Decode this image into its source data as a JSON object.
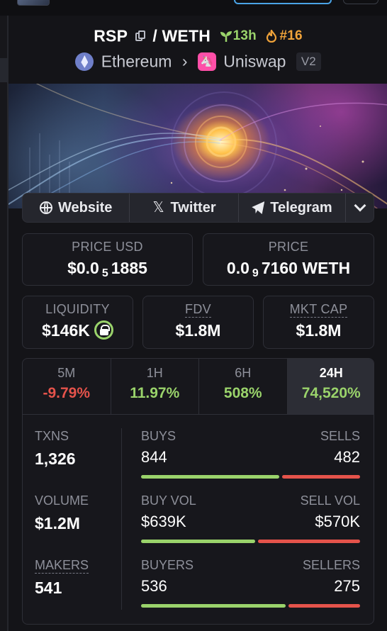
{
  "pair": {
    "base": "RSP",
    "separator": "/",
    "quote": "WETH",
    "age": "13h",
    "rank": "#16",
    "chain": "Ethereum",
    "dex": "Uniswap",
    "version": "V2"
  },
  "links": {
    "website": "Website",
    "twitter": "Twitter",
    "telegram": "Telegram"
  },
  "prices": {
    "usd_label": "PRICE USD",
    "usd_prefix": "$0.0",
    "usd_zeros": "5",
    "usd_digits": "1885",
    "native_label": "PRICE",
    "native_prefix": "0.0",
    "native_zeros": "9",
    "native_digits": "7160 WETH"
  },
  "metrics": {
    "liquidity_label": "LIQUIDITY",
    "liquidity_value": "$146K",
    "fdv_label": "FDV",
    "fdv_value": "$1.8M",
    "mcap_label": "MKT CAP",
    "mcap_value": "$1.8M"
  },
  "timeframes": [
    {
      "label": "5M",
      "change": "-9.79%"
    },
    {
      "label": "1H",
      "change": "11.97%"
    },
    {
      "label": "6H",
      "change": "508%"
    },
    {
      "label": "24H",
      "change": "74,520%"
    }
  ],
  "active_timeframe": "24H",
  "stats": {
    "txns_label": "TXNS",
    "txns_value": "1,326",
    "volume_label": "VOLUME",
    "volume_value": "$1.2M",
    "makers_label": "MAKERS",
    "makers_value": "541",
    "buys_label": "BUYS",
    "buys_value": "844",
    "sells_label": "SELLS",
    "sells_value": "482",
    "buy_vol_label": "BUY VOL",
    "buy_vol_value": "$639K",
    "sell_vol_label": "SELL VOL",
    "sell_vol_value": "$570K",
    "buyers_label": "BUYERS",
    "buyers_value": "536",
    "sellers_label": "SELLERS",
    "sellers_value": "275"
  },
  "colors": {
    "positive": "#9ad36b",
    "negative": "#e5534b",
    "rank": "#f0a33a"
  }
}
